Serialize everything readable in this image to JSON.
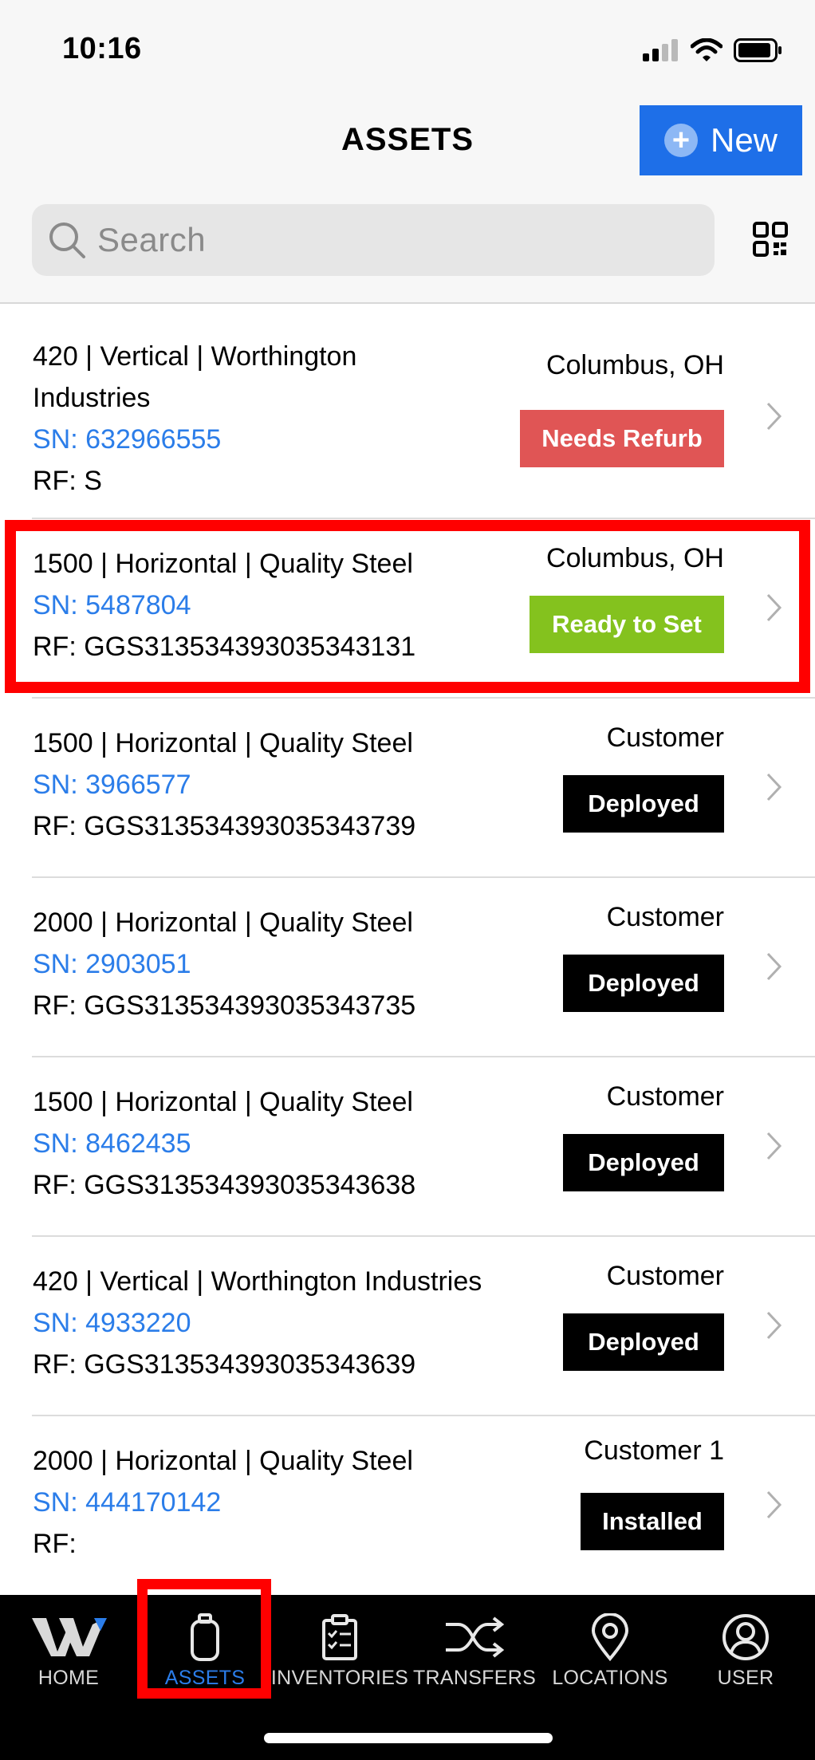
{
  "status_bar": {
    "time": "10:16"
  },
  "header": {
    "title": "ASSETS",
    "new_button": "New",
    "search_placeholder": "Search",
    "qr_icon": "qr-code-icon"
  },
  "colors": {
    "accent": "#1e6fe8",
    "link": "#2b7de9",
    "needs_refurb": "#e05555",
    "ready_to_set": "#84c21e",
    "deployed": "#000000",
    "installed": "#000000"
  },
  "assets": [
    {
      "title_line1": "420 | Vertical | Worthington",
      "title_line2": "Industries",
      "sn": "SN: 632966555",
      "rf": "RF: S",
      "location": "Columbus, OH",
      "status": "Needs Refurb"
    },
    {
      "title_line1": "1500 | Horizontal | Quality Steel",
      "sn": "SN: 5487804",
      "rf": "RF: GGS313534393035343131",
      "location": "Columbus, OH",
      "status": "Ready to Set"
    },
    {
      "title_line1": "1500 | Horizontal | Quality Steel",
      "sn": "SN: 3966577",
      "rf": "RF: GGS313534393035343739",
      "location": "Customer",
      "status": "Deployed"
    },
    {
      "title_line1": "2000 | Horizontal | Quality Steel",
      "sn": "SN: 2903051",
      "rf": "RF: GGS313534393035343735",
      "location": "Customer",
      "status": "Deployed"
    },
    {
      "title_line1": "1500 | Horizontal | Quality Steel",
      "sn": "SN: 8462435",
      "rf": "RF: GGS313534393035343638",
      "location": "Customer",
      "status": "Deployed"
    },
    {
      "title_line1": "420 | Vertical | Worthington Industries",
      "sn": "SN: 4933220",
      "rf": "RF: GGS313534393035343639",
      "location": "Customer",
      "status": "Deployed"
    },
    {
      "title_line1": "2000 | Horizontal | Quality Steel",
      "sn": "SN: 444170142",
      "rf": "RF:",
      "location": "Customer 1",
      "status": "Installed"
    }
  ],
  "tabbar": {
    "items": [
      {
        "label": "HOME",
        "icon": "home-logo-icon"
      },
      {
        "label": "ASSETS",
        "icon": "assets-icon",
        "active": true
      },
      {
        "label": "INVENTORIES",
        "icon": "inventories-icon"
      },
      {
        "label": "TRANSFERS",
        "icon": "transfers-icon"
      },
      {
        "label": "LOCATIONS",
        "icon": "locations-icon"
      },
      {
        "label": "USER",
        "icon": "user-icon"
      }
    ]
  }
}
